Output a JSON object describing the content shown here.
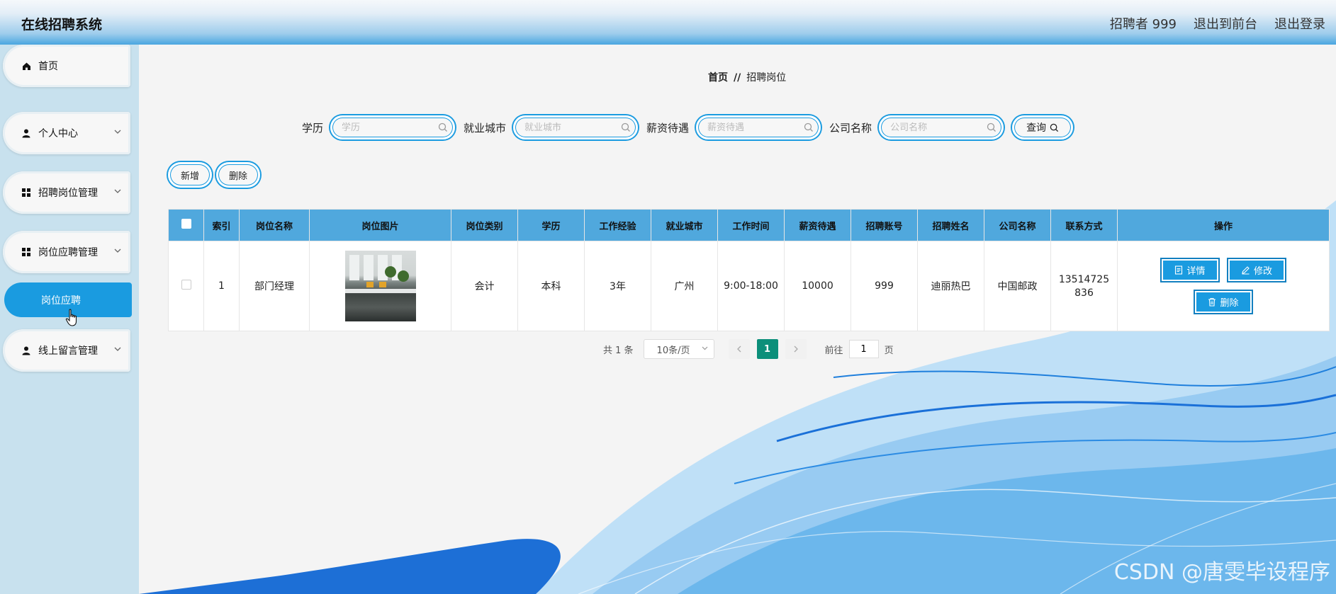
{
  "header": {
    "title": "在线招聘系统",
    "user": "招聘者 999",
    "to_front": "退出到前台",
    "logout": "退出登录"
  },
  "sidebar": {
    "items": [
      {
        "label": "首页",
        "icon": "home-icon"
      },
      {
        "label": "个人中心",
        "icon": "user-icon"
      },
      {
        "label": "招聘岗位管理",
        "icon": "grid-icon"
      },
      {
        "label": "岗位应聘管理",
        "icon": "grid-icon"
      },
      {
        "label": "线上留言管理",
        "icon": "user-icon"
      }
    ],
    "active_sub": "岗位应聘"
  },
  "breadcrumb": {
    "home": "首页",
    "sep": "//",
    "current": "招聘岗位"
  },
  "search": {
    "fields": [
      {
        "label": "学历",
        "placeholder": "学历"
      },
      {
        "label": "就业城市",
        "placeholder": "就业城市"
      },
      {
        "label": "薪资待遇",
        "placeholder": "薪资待遇"
      },
      {
        "label": "公司名称",
        "placeholder": "公司名称"
      }
    ],
    "query": "查询"
  },
  "actions": {
    "add": "新增",
    "delete": "删除"
  },
  "table": {
    "headers": [
      "索引",
      "岗位名称",
      "岗位图片",
      "岗位类别",
      "学历",
      "工作经验",
      "就业城市",
      "工作时间",
      "薪资待遇",
      "招聘账号",
      "招聘姓名",
      "公司名称",
      "联系方式",
      "操作"
    ],
    "rows": [
      {
        "index": "1",
        "name": "部门经理",
        "category": "会计",
        "education": "本科",
        "experience": "3年",
        "city": "广州",
        "worktime": "9:00-18:00",
        "salary": "10000",
        "account": "999",
        "recruiter": "迪丽热巴",
        "company": "中国邮政",
        "phone1": "13514725",
        "phone2": "836",
        "detail": "详情",
        "edit": "修改",
        "remove": "删除"
      }
    ]
  },
  "pagination": {
    "total": "共 1 条",
    "page_size": "10条/页",
    "current": "1",
    "goto_prefix": "前往",
    "goto_value": "1",
    "goto_suffix": "页"
  },
  "watermark": "CSDN @唐雯毕设程序",
  "colors": {
    "accent": "#1a9be0",
    "sidebar_bg": "#c8e1ee",
    "table_header": "#50a8dd",
    "page_active": "#0c8f7a"
  }
}
